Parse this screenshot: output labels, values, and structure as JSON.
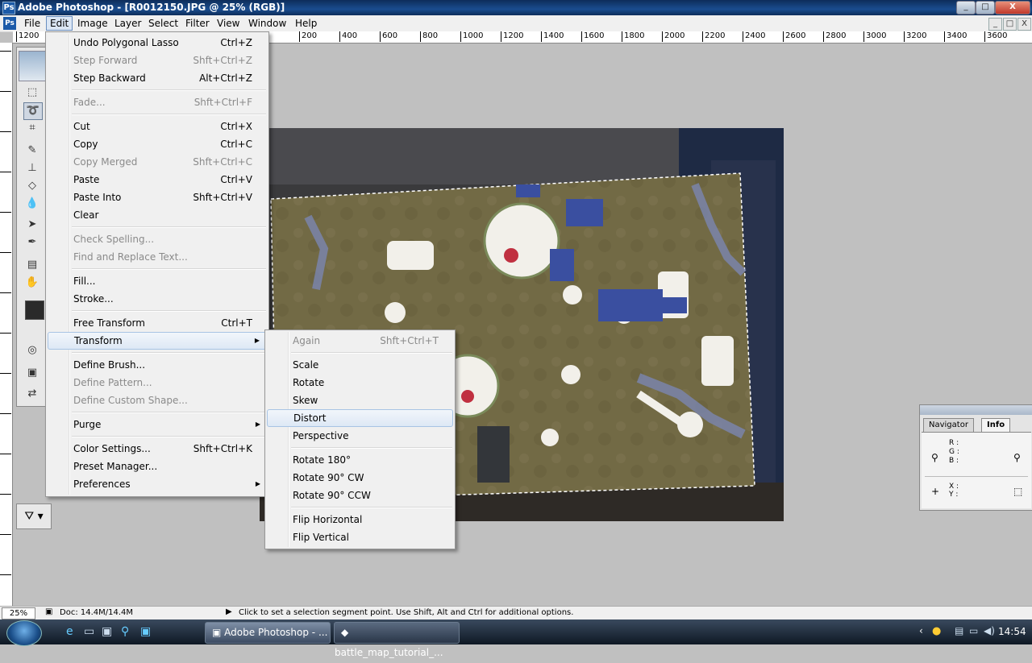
{
  "window": {
    "title": "Adobe Photoshop - [R0012150.JPG @ 25% (RGB)]",
    "controls": {
      "minimize": "_",
      "maximize": "□",
      "close": "X"
    }
  },
  "menubar": {
    "items": [
      "File",
      "Edit",
      "Image",
      "Layer",
      "Select",
      "Filter",
      "View",
      "Window",
      "Help"
    ],
    "active": "Edit"
  },
  "ruler": {
    "labels": [
      "1200",
      "200",
      "400",
      "600",
      "800",
      "1000",
      "1200",
      "1400",
      "1600",
      "1800",
      "2000",
      "2200",
      "2400",
      "2600",
      "2800",
      "3000",
      "3200",
      "3400",
      "3600"
    ]
  },
  "edit_menu": [
    {
      "label": "Undo Polygonal Lasso",
      "shortcut": "Ctrl+Z",
      "enabled": true
    },
    {
      "label": "Step Forward",
      "shortcut": "Shft+Ctrl+Z",
      "enabled": false
    },
    {
      "label": "Step Backward",
      "shortcut": "Alt+Ctrl+Z",
      "enabled": true
    },
    {
      "label": "Fade...",
      "shortcut": "Shft+Ctrl+F",
      "enabled": false
    },
    {
      "label": "Cut",
      "shortcut": "Ctrl+X",
      "enabled": true
    },
    {
      "label": "Copy",
      "shortcut": "Ctrl+C",
      "enabled": true
    },
    {
      "label": "Copy Merged",
      "shortcut": "Shft+Ctrl+C",
      "enabled": false
    },
    {
      "label": "Paste",
      "shortcut": "Ctrl+V",
      "enabled": true
    },
    {
      "label": "Paste Into",
      "shortcut": "Shft+Ctrl+V",
      "enabled": true
    },
    {
      "label": "Clear",
      "shortcut": "",
      "enabled": true
    },
    {
      "label": "Check Spelling...",
      "shortcut": "",
      "enabled": false
    },
    {
      "label": "Find and Replace Text...",
      "shortcut": "",
      "enabled": false
    },
    {
      "label": "Fill...",
      "shortcut": "",
      "enabled": true
    },
    {
      "label": "Stroke...",
      "shortcut": "",
      "enabled": true
    },
    {
      "label": "Free Transform",
      "shortcut": "Ctrl+T",
      "enabled": true
    },
    {
      "label": "Transform",
      "shortcut": "",
      "enabled": true,
      "submenu": true,
      "highlighted": true
    },
    {
      "label": "Define Brush...",
      "shortcut": "",
      "enabled": true
    },
    {
      "label": "Define Pattern...",
      "shortcut": "",
      "enabled": false
    },
    {
      "label": "Define Custom Shape...",
      "shortcut": "",
      "enabled": false
    },
    {
      "label": "Purge",
      "shortcut": "",
      "enabled": true,
      "submenu": true
    },
    {
      "label": "Color Settings...",
      "shortcut": "Shft+Ctrl+K",
      "enabled": true
    },
    {
      "label": "Preset Manager...",
      "shortcut": "",
      "enabled": true
    },
    {
      "label": "Preferences",
      "shortcut": "",
      "enabled": true,
      "submenu": true
    }
  ],
  "transform_menu": [
    {
      "label": "Again",
      "shortcut": "Shft+Ctrl+T",
      "enabled": false
    },
    {
      "label": "Scale",
      "shortcut": "",
      "enabled": true
    },
    {
      "label": "Rotate",
      "shortcut": "",
      "enabled": true
    },
    {
      "label": "Skew",
      "shortcut": "",
      "enabled": true
    },
    {
      "label": "Distort",
      "shortcut": "",
      "enabled": true,
      "highlighted": true
    },
    {
      "label": "Perspective",
      "shortcut": "",
      "enabled": true
    },
    {
      "label": "Rotate 180°",
      "shortcut": "",
      "enabled": true
    },
    {
      "label": "Rotate 90° CW",
      "shortcut": "",
      "enabled": true
    },
    {
      "label": "Rotate 90° CCW",
      "shortcut": "",
      "enabled": true
    },
    {
      "label": "Flip Horizontal",
      "shortcut": "",
      "enabled": true
    },
    {
      "label": "Flip Vertical",
      "shortcut": "",
      "enabled": true
    }
  ],
  "palette": {
    "tabs": [
      "Navigator",
      "Info"
    ],
    "active_tab": "Info",
    "rgb_labels": [
      "R :",
      "G :",
      "B :"
    ],
    "xy_labels": [
      "X :",
      "Y :"
    ]
  },
  "statusbar": {
    "zoom": "25%",
    "doc": "Doc: 14.4M/14.4M",
    "hint": "Click to set a selection segment point.  Use Shift, Alt and Ctrl for additional options."
  },
  "taskbar": {
    "buttons": [
      "Adobe Photoshop - ...",
      "battle_map_tutorial_..."
    ],
    "clock": "14:54"
  },
  "colors": {
    "title_bar": "#1a4d8f",
    "menu_highlight": "#dde8f5",
    "canvas_table": "#6b6240"
  }
}
